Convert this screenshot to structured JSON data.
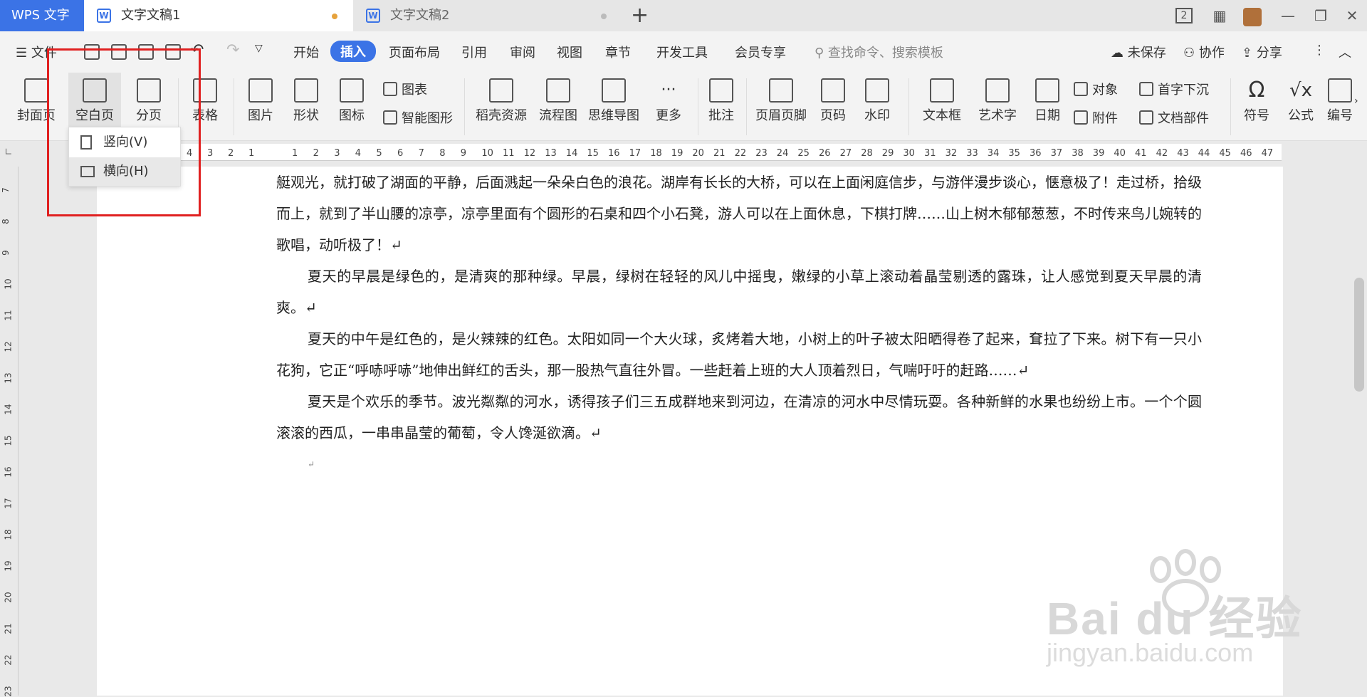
{
  "titlebar": {
    "app_name": "WPS 文字",
    "tabs": [
      {
        "label": "文字文稿1",
        "active": true
      },
      {
        "label": "文字文稿2",
        "active": false
      }
    ],
    "new_tab": "+",
    "page_indicator": "2"
  },
  "menubar": {
    "file": "文件",
    "items": [
      "开始",
      "插入",
      "页面布局",
      "引用",
      "审阅",
      "视图",
      "章节",
      "开发工具",
      "会员专享"
    ],
    "active": "插入",
    "search_placeholder": "查找命令、搜索模板",
    "right": [
      "未保存",
      "协作",
      "分享"
    ]
  },
  "ribbon": {
    "large": [
      "封面页",
      "空白页",
      "分页",
      "表格",
      "图片",
      "形状",
      "图标",
      "稻壳资源",
      "流程图",
      "思维导图",
      "更多",
      "批注",
      "页眉页脚",
      "页码",
      "水印",
      "文本框",
      "艺术字",
      "日期",
      "符号",
      "公式",
      "编号"
    ],
    "small": [
      "图表",
      "智能图形",
      "对象",
      "首字下沉",
      "附件",
      "文档部件"
    ]
  },
  "dropdown": {
    "items": [
      {
        "label": "竖向(V)"
      },
      {
        "label": "横向(H)",
        "highlighted": true
      }
    ]
  },
  "ruler": {
    "left_numbers": [
      "4",
      "3",
      "2",
      "1"
    ],
    "numbers": [
      "1",
      "2",
      "3",
      "4",
      "5",
      "6",
      "7",
      "8",
      "9",
      "10",
      "11",
      "12",
      "13",
      "14",
      "15",
      "16",
      "17",
      "18",
      "19",
      "20",
      "21",
      "22",
      "23",
      "24",
      "25",
      "26",
      "27",
      "28",
      "29",
      "30",
      "31",
      "32",
      "33",
      "34",
      "35",
      "36",
      "37",
      "38",
      "39",
      "40",
      "41",
      "42",
      "43",
      "44",
      "45",
      "46",
      "47"
    ],
    "vertical": [
      "7",
      "8",
      "9",
      "10",
      "11",
      "12",
      "13",
      "14",
      "15",
      "16",
      "17",
      "18",
      "19",
      "20",
      "21",
      "22",
      "23"
    ]
  },
  "document": {
    "paragraphs": [
      {
        "text": "艇观光，就打破了湖面的平静，后面溅起一朵朵白色的浪花。湖岸有长长的大桥，可以在上面闲庭信步，与游伴漫步谈心，惬意极了！走过桥，拾级而上，就到了半山腰的凉亭，凉亭里面有个圆形的石桌和四个小石凳，游人可以在上面休息，下棋打牌……山上树木郁郁葱葱，不时传来鸟儿婉转的歌唱，动听极了！↵",
        "indent": false
      },
      {
        "text": "夏天的早晨是绿色的，是清爽的那种绿。早晨，绿树在轻轻的风儿中摇曳，嫩绿的小草上滚动着晶莹剔透的露珠，让人感觉到夏天早晨的清爽。↵",
        "indent": true
      },
      {
        "text": "夏天的中午是红色的，是火辣辣的红色。太阳如同一个大火球，炙烤着大地，小树上的叶子被太阳晒得卷了起来，耷拉了下来。树下有一只小花狗，它正“呼哧呼哧”地伸出鲜红的舌头，那一股热气直往外冒。一些赶着上班的大人顶着烈日，气喘吁吁的赶路……↵",
        "indent": true
      },
      {
        "text": "夏天是个欢乐的季节。波光粼粼的河水，诱得孩子们三五成群地来到河边，在清凉的河水中尽情玩耍。各种新鲜的水果也纷纷上市。一个个圆滚滚的西瓜，一串串晶莹的葡萄，令人馋涎欲滴。↵",
        "indent": true
      },
      {
        "text": "↵",
        "indent": true
      }
    ]
  },
  "watermark": {
    "brand": "Bai du 经验",
    "url": "jingyan.baidu.com"
  },
  "colors": {
    "accent": "#3b73e6",
    "highlight_box": "#e02020"
  }
}
